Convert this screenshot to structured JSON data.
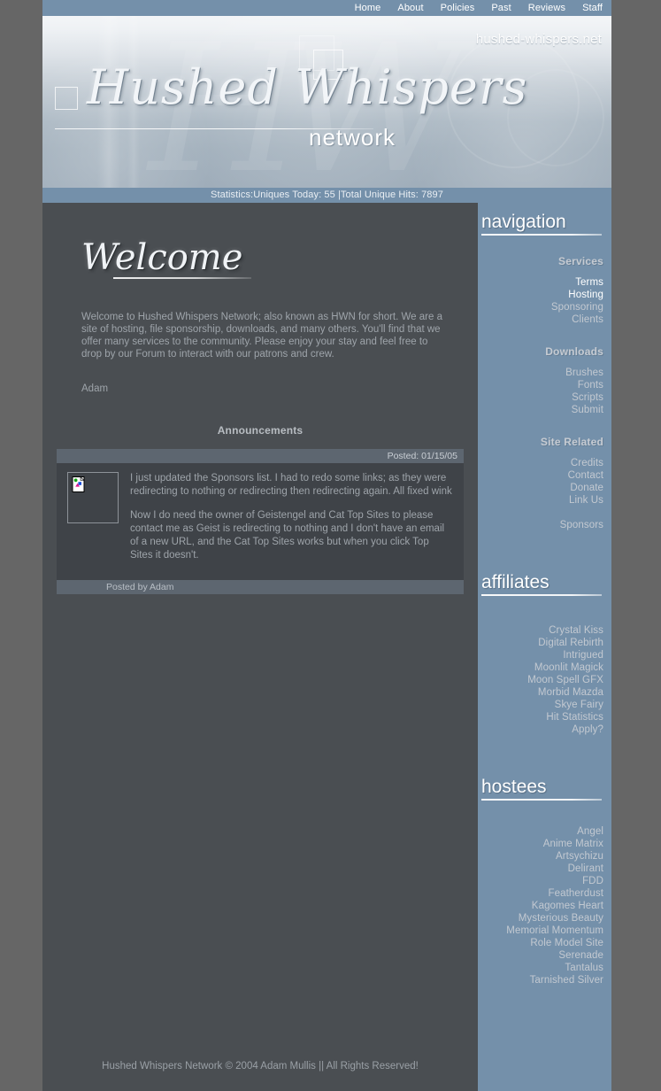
{
  "topnav": {
    "items": [
      {
        "label": "Home"
      },
      {
        "label": "About"
      },
      {
        "label": "Policies"
      },
      {
        "label": "Past"
      },
      {
        "label": "Reviews"
      },
      {
        "label": "Staff"
      }
    ]
  },
  "header": {
    "site_url": "hushed-whispers.net",
    "logo_script": "Hushed Whispers",
    "logo_network": "network"
  },
  "stats": {
    "text": "Statistics:Uniques Today: 55 |Total Unique Hits: 7897"
  },
  "content": {
    "welcome_title": "Welcome",
    "intro": "Welcome to Hushed Whispers Network; also known as HWN for short. We are a site of hosting, file sponsorship, downloads, and many others. You'll find that we offer many services to the community. Please enjoy your stay and feel free to drop by our Forum to interact with our patrons and crew.",
    "signature": "Adam",
    "announcements_heading": "Announcements",
    "announcement": {
      "posted": "Posted: 01/15/05",
      "posted_by": "Posted by Adam",
      "thumb_icon": "broken-image-icon",
      "paragraphs": [
        "I just updated the Sponsors list. I had to redo some links; as they were redirecting to nothing or redirecting then redirecting again. All fixed wink",
        "Now I do need the owner of Geistengel and Cat Top Sites to please contact me as Geist is redirecting to nothing and I don't have an email of a new URL, and the Cat Top Sites works but when you click Top Sites it doesn't."
      ]
    }
  },
  "sidebar": {
    "navigation": {
      "heading": "navigation",
      "groups": [
        {
          "title": "Services",
          "links": [
            {
              "label": "Terms",
              "highlight": true
            },
            {
              "label": "Hosting",
              "highlight": true
            },
            {
              "label": "Sponsoring",
              "highlight": false
            },
            {
              "label": "Clients",
              "highlight": false
            }
          ]
        },
        {
          "title": "Downloads",
          "links": [
            {
              "label": "Brushes",
              "highlight": false
            },
            {
              "label": "Fonts",
              "highlight": false
            },
            {
              "label": "Scripts",
              "highlight": false
            },
            {
              "label": "Submit",
              "highlight": false
            }
          ]
        },
        {
          "title": "Site Related",
          "links": [
            {
              "label": "Credits",
              "highlight": false
            },
            {
              "label": "Contact",
              "highlight": false
            },
            {
              "label": "Donate",
              "highlight": false
            },
            {
              "label": "Link Us",
              "highlight": false
            },
            {
              "label": "",
              "highlight": false
            },
            {
              "label": "Sponsors",
              "highlight": false
            }
          ]
        }
      ]
    },
    "affiliates": {
      "heading": "affiliates",
      "links": [
        {
          "label": "Crystal Kiss"
        },
        {
          "label": "Digital Rebirth"
        },
        {
          "label": "Intrigued"
        },
        {
          "label": "Moonlit Magick"
        },
        {
          "label": "Moon Spell GFX"
        },
        {
          "label": "Morbid Mazda"
        },
        {
          "label": "Skye Fairy"
        },
        {
          "label": "Hit Statistics"
        },
        {
          "label": "Apply?"
        }
      ]
    },
    "hostees": {
      "heading": "hostees",
      "links": [
        {
          "label": "Angel"
        },
        {
          "label": "Anime Matrix"
        },
        {
          "label": "Artsychizu"
        },
        {
          "label": "Delirant"
        },
        {
          "label": "FDD"
        },
        {
          "label": "Featherdust"
        },
        {
          "label": "Kagomes Heart"
        },
        {
          "label": "Mysterious Beauty"
        },
        {
          "label": "Memorial Momentum"
        },
        {
          "label": "Role Model Site"
        },
        {
          "label": "Serenade"
        },
        {
          "label": "Tantalus"
        },
        {
          "label": "Tarnished Silver"
        }
      ]
    }
  },
  "footer": {
    "text": "Hushed Whispers Network © 2004 Adam Mullis || All Rights Reserved!"
  },
  "colors": {
    "page_bg": "#666666",
    "accent_blue": "#7490aa",
    "content_bg": "#4a4e52",
    "panel_bg": "#3f4348",
    "bar_bg": "#5d6670",
    "link": "#c3c9d1",
    "link_hot": "#ffffff"
  }
}
